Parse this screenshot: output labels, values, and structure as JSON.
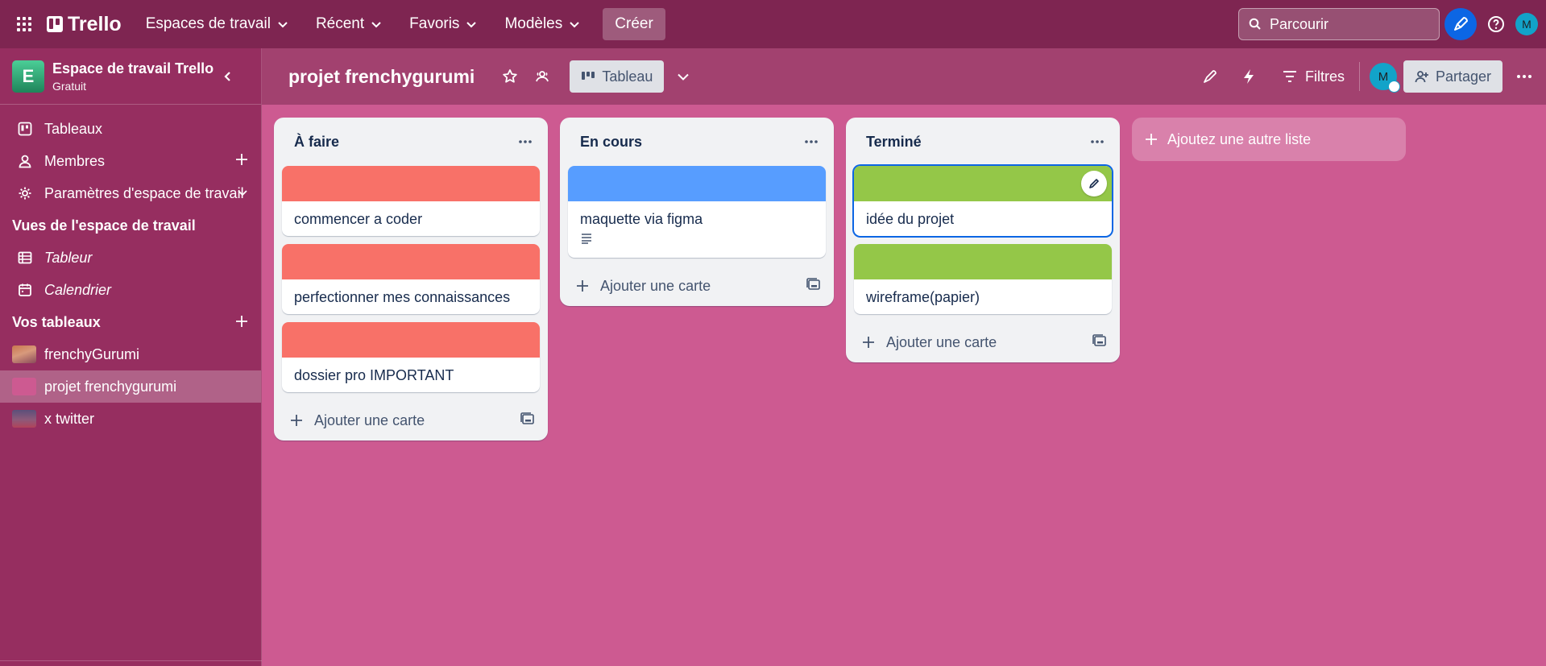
{
  "nav": {
    "brand": "Trello",
    "menu": [
      {
        "label": "Espaces de travail"
      },
      {
        "label": "Récent"
      },
      {
        "label": "Favoris"
      },
      {
        "label": "Modèles"
      }
    ],
    "create_label": "Créer",
    "search_placeholder": "Parcourir",
    "avatar_initial": "M"
  },
  "sidebar": {
    "workspace_initial": "E",
    "workspace_name": "Espace de travail Trello",
    "workspace_plan": "Gratuit",
    "items": [
      {
        "label": "Tableaux",
        "icon": "board-icon"
      },
      {
        "label": "Membres",
        "icon": "person-icon"
      },
      {
        "label": "Paramètres d'espace de travail",
        "icon": "gear-icon"
      }
    ],
    "views_title": "Vues de l'espace de travail",
    "views": [
      {
        "label": "Tableur",
        "icon": "table-icon"
      },
      {
        "label": "Calendrier",
        "icon": "calendar-icon"
      }
    ],
    "boards_title": "Vos tableaux",
    "boards": [
      {
        "label": "frenchyGurumi",
        "active": false
      },
      {
        "label": "projet frenchygurumi",
        "active": true
      },
      {
        "label": "x twitter",
        "active": false
      }
    ]
  },
  "board": {
    "title": "projet frenchygurumi",
    "view_label": "Tableau",
    "filters_label": "Filtres",
    "member_initial": "M",
    "share_label": "Partager"
  },
  "lists": [
    {
      "title": "À faire",
      "cards": [
        {
          "text": "commencer a coder",
          "cover": "#f87168"
        },
        {
          "text": "perfectionner mes connaissances",
          "cover": "#f87168"
        },
        {
          "text": "dossier pro IMPORTANT",
          "cover": "#f87168"
        }
      ],
      "add_card_label": "Ajouter une carte"
    },
    {
      "title": "En cours",
      "cards": [
        {
          "text": "maquette via figma",
          "cover": "#579dff",
          "has_description": true
        }
      ],
      "add_card_label": "Ajouter une carte"
    },
    {
      "title": "Terminé",
      "cards": [
        {
          "text": "idée du projet",
          "cover": "#94c748",
          "selected": true
        },
        {
          "text": "wireframe(papier)",
          "cover": "#94c748"
        }
      ],
      "add_card_label": "Ajouter une carte"
    }
  ],
  "add_list_label": "Ajoutez une autre liste",
  "colors": {
    "topnav": "#7e2551",
    "sidebar": "#962e60",
    "board_bg": "#cd5a91",
    "board_header": "#a2416f"
  }
}
